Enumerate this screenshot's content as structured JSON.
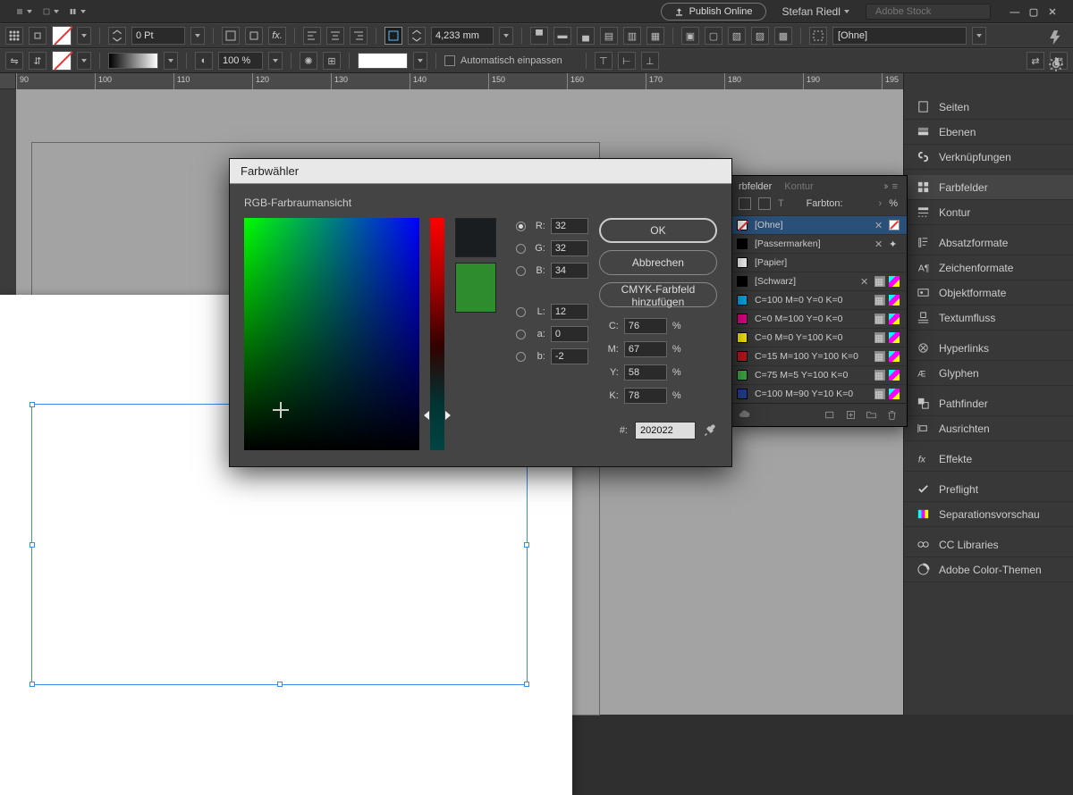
{
  "menubar": {
    "publish": "Publish Online",
    "username": "Stefan Riedl",
    "stock_placeholder": "Adobe Stock"
  },
  "controlbar": {
    "stroke_weight": "0 Pt",
    "frame_size": "4,233 mm",
    "zoom": "100 %",
    "autofit_label": "Automatisch einpassen",
    "picker": "[Ohne]"
  },
  "ruler": {
    "ticks": [
      "90",
      "100",
      "110",
      "120",
      "130",
      "140",
      "150",
      "160",
      "170",
      "180",
      "190",
      "195"
    ]
  },
  "right_panel": {
    "items": [
      "Seiten",
      "Ebenen",
      "Verknüpfungen",
      "Farbfelder",
      "Kontur",
      "Absatzformate",
      "Zeichenformate",
      "Objektformate",
      "Textumfluss",
      "Hyperlinks",
      "Glyphen",
      "Pathfinder",
      "Ausrichten",
      "Effekte",
      "Preflight",
      "Separationsvorschau",
      "CC Libraries",
      "Adobe Color-Themen"
    ],
    "selected": 3
  },
  "swatches": {
    "tab_active": "rbfelder",
    "tab_other": "Kontur",
    "tint_label": "Farbton:",
    "tint_unit": "%",
    "items": [
      {
        "name": "[Ohne]",
        "chip": "none",
        "lock": true,
        "mode": "none",
        "sel": true
      },
      {
        "name": "[Passermarken]",
        "chip": "#000",
        "lock": true,
        "mode": "reg"
      },
      {
        "name": "[Papier]",
        "chip": "#fff"
      },
      {
        "name": "[Schwarz]",
        "chip": "#000",
        "lock": true,
        "mode": "cmyk"
      },
      {
        "name": "C=100 M=0 Y=0 K=0",
        "chip": "#00aeef",
        "mode": "cmyk"
      },
      {
        "name": "C=0 M=100 Y=0 K=0",
        "chip": "#ec008c",
        "mode": "cmyk"
      },
      {
        "name": "C=0 M=0 Y=100 K=0",
        "chip": "#fff200",
        "mode": "cmyk"
      },
      {
        "name": "C=15 M=100 Y=100 K=0",
        "chip": "#c4161c",
        "mode": "cmyk"
      },
      {
        "name": "C=75 M=5 Y=100 K=0",
        "chip": "#3fae49",
        "mode": "cmyk"
      },
      {
        "name": "C=100 M=90 Y=10 K=0",
        "chip": "#21409a",
        "mode": "cmyk"
      }
    ]
  },
  "dialog": {
    "title": "Farbwähler",
    "section": "RGB-Farbraumansicht",
    "ok": "OK",
    "cancel": "Abbrechen",
    "add_cmyk": "CMYK-Farbfeld hinzufügen",
    "rgb": {
      "R": "32",
      "G": "32",
      "B": "34"
    },
    "lab": {
      "L": "12",
      "a": "0",
      "b": "-2"
    },
    "cmyk": {
      "C": "76",
      "M": "67",
      "Y": "58",
      "K": "78"
    },
    "hex_label": "#:",
    "hex": "202022",
    "percent": "%"
  }
}
